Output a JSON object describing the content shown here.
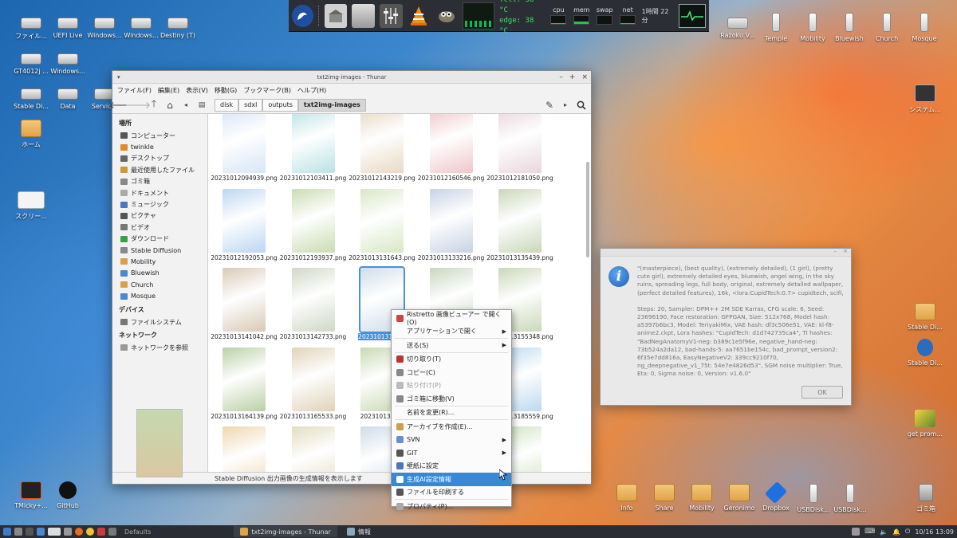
{
  "top_panel": {
    "temps": [
      "Tctl: 38 °C",
      "edge: 38 °C"
    ],
    "monitors": [
      {
        "label": "cpu",
        "level": 0.15
      },
      {
        "label": "mem",
        "level": 0.35
      },
      {
        "label": "swap",
        "level": 0.0
      },
      {
        "label": "net",
        "level": 0.1
      }
    ],
    "uptime": "1時間 22分"
  },
  "desktop_left": [
    {
      "label": "ファイル...",
      "icon": "drive"
    },
    {
      "label": "UEFI Live",
      "icon": "drive"
    },
    {
      "label": "Windows...",
      "icon": "drive"
    },
    {
      "label": "Windows...",
      "icon": "drive"
    },
    {
      "label": "Destiny (T)",
      "icon": "drive"
    },
    {
      "label": "GT4012j ...",
      "icon": "drive"
    },
    {
      "label": "Windows...",
      "icon": "drive"
    },
    {
      "label": "Stable Di...",
      "icon": "drive"
    },
    {
      "label": "Data",
      "icon": "drive"
    },
    {
      "label": "Servic...",
      "icon": "drive"
    },
    {
      "label": "ホーム",
      "icon": "home"
    },
    {
      "label": "スクリー...",
      "icon": "image"
    },
    {
      "label": "TMicky+...",
      "icon": "app"
    },
    {
      "label": "GitHub",
      "icon": "github"
    }
  ],
  "desktop_top_right": [
    "Razoku V...",
    "Temple",
    "Mobility",
    "Bluewish",
    "Church",
    "Mosque"
  ],
  "desktop_right": [
    "システム...",
    "Stable Di...",
    "Stable Di...",
    "get prom..."
  ],
  "desktop_bottom": [
    "Info",
    "Share",
    "Mobility",
    "Geronimo",
    "Dropbox",
    "USBDisk...",
    "USBDisk...",
    "ゴミ箱"
  ],
  "thunar": {
    "title": "txt2img-images - Thunar",
    "menu": [
      "ファイル(F)",
      "編集(E)",
      "表示(V)",
      "移動(G)",
      "ブックマーク(B)",
      "ヘルプ(H)"
    ],
    "breadcrumbs": [
      "disk",
      "sdxl",
      "outputs",
      "txt2img-images"
    ],
    "sidebar": {
      "places_header": "場所",
      "places": [
        {
          "label": "コンピューター",
          "color": "#555"
        },
        {
          "label": "twinkle",
          "color": "#e08a2a"
        },
        {
          "label": "デスクトップ",
          "color": "#666"
        },
        {
          "label": "最近使用したファイル",
          "color": "#c79a3a"
        },
        {
          "label": "ゴミ箱",
          "color": "#888"
        },
        {
          "label": "ドキュメント",
          "color": "#aaa"
        },
        {
          "label": "ミュージック",
          "color": "#4a78c0"
        },
        {
          "label": "ピクチャ",
          "color": "#555"
        },
        {
          "label": "ビデオ",
          "color": "#777"
        },
        {
          "label": "ダウンロード",
          "color": "#3aa04a"
        },
        {
          "label": "Stable Diffusion",
          "color": "#888"
        },
        {
          "label": "Mobility",
          "color": "#d9a04a"
        },
        {
          "label": "Bluewish",
          "color": "#4a88d0"
        },
        {
          "label": "Church",
          "color": "#d9a04a"
        },
        {
          "label": "Mosque",
          "color": "#4a88d0"
        }
      ],
      "devices_header": "デバイス",
      "devices": [
        {
          "label": "ファイルシステム",
          "color": "#777"
        }
      ],
      "network_header": "ネットワーク",
      "network": [
        {
          "label": "ネットワークを参照",
          "color": "#999"
        }
      ]
    },
    "files": [
      {
        "name": "20231012094939.png",
        "color": "#d6e6f7"
      },
      {
        "name": "20231012103411.png",
        "color": "#b9e2e4"
      },
      {
        "name": "20231012143219.png",
        "color": "#e8d9c4"
      },
      {
        "name": "20231012160546.png",
        "color": "#f0c7c9"
      },
      {
        "name": "20231012181050.png",
        "color": "#e9d6dc"
      },
      {
        "name": "20231012192053.png",
        "color": "#bcd6f2"
      },
      {
        "name": "20231012193937.png",
        "color": "#c9dcb0"
      },
      {
        "name": "20231013131643.png",
        "color": "#d8e7c6"
      },
      {
        "name": "20231013133216.png",
        "color": "#c6d3e4"
      },
      {
        "name": "20231013135439.png",
        "color": "#c9d7b8"
      },
      {
        "name": "20231013141042.png",
        "color": "#d9c9b6"
      },
      {
        "name": "20231013142733.png",
        "color": "#cfd8c4"
      },
      {
        "name": "20231013152...",
        "color": "#cfdde9",
        "selected": true
      },
      {
        "name": "",
        "color": "#c8d6c0"
      },
      {
        "name": "20231013155348.png",
        "color": "#c9d8b8"
      },
      {
        "name": "20231013164139.png",
        "color": "#b9d0a6"
      },
      {
        "name": "20231013165533.png",
        "color": "#e0d2b8"
      },
      {
        "name": "2023101317...",
        "color": "#c7d9b2"
      },
      {
        "name": "",
        "color": "#c8dae4"
      },
      {
        "name": "20231013185559.png",
        "color": "#bcd9f0"
      },
      {
        "name": "",
        "color": "#f0d6b0"
      },
      {
        "name": "",
        "color": "#e3ddc0"
      },
      {
        "name": "",
        "color": "#cfdbe9"
      },
      {
        "name": "",
        "color": "#d3e0c0"
      },
      {
        "name": "",
        "color": "#cde2c0"
      }
    ],
    "status": "Stable Diffusion 出力画像の生成情報を表示します"
  },
  "context_menu": {
    "items": [
      {
        "label": "Ristretto 画像ビューアー で開く(O)",
        "icon_color": "#c44"
      },
      {
        "label": "アプリケーションで開く",
        "submenu": true
      },
      {
        "sep": true
      },
      {
        "label": "送る(S)",
        "submenu": true
      },
      {
        "sep": true
      },
      {
        "label": "切り取り(T)",
        "icon_color": "#b33"
      },
      {
        "label": "コピー(C)",
        "icon_color": "#888"
      },
      {
        "label": "貼り付け(P)",
        "icon_color": "#bbb",
        "disabled": true
      },
      {
        "label": "ゴミ箱に移動(V)",
        "icon_color": "#888"
      },
      {
        "sep": true
      },
      {
        "label": "名前を変更(R)..."
      },
      {
        "sep": true
      },
      {
        "label": "アーカイブを作成(E)...",
        "icon_color": "#c8a050"
      },
      {
        "label": "SVN",
        "icon_color": "#6a8fd0",
        "submenu": true
      },
      {
        "label": "GIT",
        "icon_color": "#555",
        "submenu": true
      },
      {
        "label": "壁紙に設定",
        "icon_color": "#4a78c0"
      },
      {
        "label": "生成AI設定情報",
        "icon_color": "#fff",
        "highlighted": true
      },
      {
        "label": "ファイルを印刷する",
        "icon_color": "#555"
      },
      {
        "sep": true
      },
      {
        "label": "プロパティ(P)...",
        "icon_color": "#aaa"
      }
    ]
  },
  "dialog": {
    "paragraphs": [
      "\"(masterpiece), (best quality), (extremely detailed), (1 girl), (pretty cute girl), extremely detailed eyes, bluewish, angel wing, in the sky ruins, spreading legs, full body, original, extremely detailed wallpaper, (perfect detailed features), 16k, <lora:CupidTech:0.7> cupidtech, scifi,",
      "Steps: 20, Sampler: DPM++ 2M SDE Karras, CFG scale: 6, Seed: 23696190, Face restoration: GFPGAN, Size: 512x768, Model hash: a5397b6bc3, Model: TeriyakiMix, VAE hash: df3c506e51, VAE: kl-f8-anime2.ckpt, Lora hashes: \"CupidTech: d1d742735ca4\", TI hashes: \"BadNegAnatomyV1-neg: b389c1e5f96e, negative_hand-neg: 73b524a2da12, bad-hands-5: aa7651be154c, bad_prompt_version2: 6f35e7dd816a, EasyNegativeV2: 339cc9210f70, ng_deepnegative_v1_75t: 54e7e4826d53\", SGM noise multiplier: True, Eta: 0, Sigma noise: 0, Version: v1.6.0\""
    ],
    "ok_label": "OK"
  },
  "taskbar": {
    "launcher_label": "Defaults",
    "tasks": [
      {
        "label": "txt2img-images - Thunar",
        "active": true
      },
      {
        "label": "情報",
        "active": false
      }
    ],
    "clock": "10/16 13:09"
  }
}
